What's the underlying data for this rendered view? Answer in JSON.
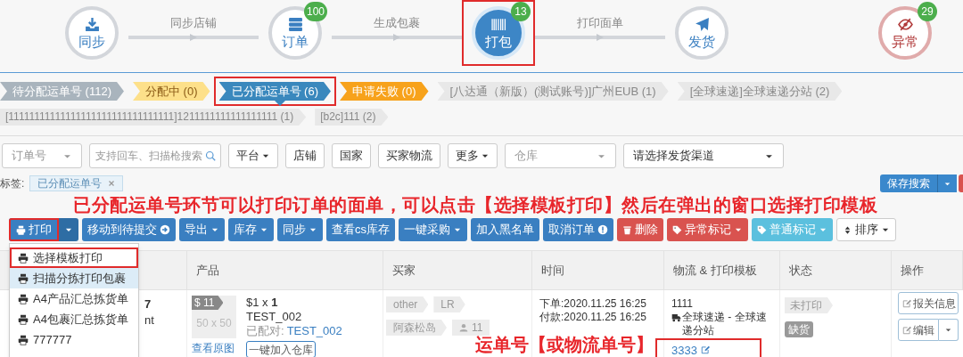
{
  "workflow": {
    "steps": [
      {
        "label": "同步",
        "kind": "normal",
        "highlighted": false
      },
      {
        "label": "订单",
        "kind": "normal",
        "badge": "100",
        "highlighted": false
      },
      {
        "label": "打包",
        "kind": "active",
        "badge": "13",
        "highlighted": true
      },
      {
        "label": "发货",
        "kind": "normal",
        "highlighted": false
      },
      {
        "label": "异常",
        "kind": "alert",
        "badge": "29",
        "highlighted": false
      }
    ],
    "connectors": [
      "同步店铺",
      "生成包裹",
      "打印面单"
    ]
  },
  "status_tabs": [
    {
      "label": "待分配运单号 (112)",
      "kind": "pending",
      "selected": false,
      "highlighted": false
    },
    {
      "label": "分配中 (0)",
      "kind": "progress",
      "selected": false,
      "highlighted": false
    },
    {
      "label": "已分配运单号 (6)",
      "kind": "assigned",
      "selected": true,
      "highlighted": true
    },
    {
      "label": "申请失败 (0)",
      "kind": "failed",
      "selected": false,
      "highlighted": false
    },
    {
      "label": "[八达通（新版）(测试账号)]广州EUB (1)",
      "kind": "channel",
      "selected": false,
      "highlighted": false
    },
    {
      "label": "[全球速递]全球速递分站 (2)",
      "kind": "channel",
      "selected": false,
      "highlighted": false
    }
  ],
  "more_channel_tabs": [
    {
      "label": "[11111111111111111111111111111111]1211111111111111111 (1)",
      "selected": false
    },
    {
      "label": "[b2c]111 (2)",
      "selected": false
    }
  ],
  "filters": {
    "order_field": {
      "placeholder": "订单号"
    },
    "search": {
      "placeholder": "支持回车、扫描枪搜索"
    },
    "buttons": [
      {
        "label": "平台",
        "dropdown": true
      },
      {
        "label": "店铺",
        "dropdown": false
      },
      {
        "label": "国家",
        "dropdown": false
      },
      {
        "label": "买家物流",
        "dropdown": false
      },
      {
        "label": "更多",
        "dropdown": true
      }
    ],
    "warehouse": {
      "placeholder": "仓库"
    },
    "channel": {
      "value": "请选择发货渠道"
    }
  },
  "tags": {
    "label": "标签:",
    "items": [
      "已分配运单号"
    ]
  },
  "save_search": "保存搜索",
  "annotations": [
    {
      "kind": "banner",
      "text": "已分配运单号环节可以打印订单的面单，可以点击【选择模板打印】然后在弹出的窗口选择打印模板"
    },
    {
      "kind": "callout",
      "text": "运单号【或物流单号】"
    }
  ],
  "toolbar": [
    {
      "label": "打印",
      "kind": "primary",
      "dropdown": true,
      "highlighted": true
    },
    {
      "label": "移动到待提交",
      "kind": "primary",
      "dropdown": false,
      "highlighted": false
    },
    {
      "label": "导出",
      "kind": "primary",
      "dropdown": true,
      "highlighted": false
    },
    {
      "label": "库存",
      "kind": "primary",
      "dropdown": true,
      "highlighted": false
    },
    {
      "label": "同步",
      "kind": "primary",
      "dropdown": true,
      "highlighted": false
    },
    {
      "label": "查看cs库存",
      "kind": "primary",
      "dropdown": false,
      "highlighted": false
    },
    {
      "label": "一键采购",
      "kind": "primary",
      "dropdown": true,
      "highlighted": false
    },
    {
      "label": "加入黑名单",
      "kind": "primary",
      "dropdown": false,
      "highlighted": false
    },
    {
      "label": "取消订单",
      "kind": "primary",
      "dropdown": false,
      "highlighted": false
    },
    {
      "label": "删除",
      "kind": "danger",
      "dropdown": false,
      "highlighted": false
    },
    {
      "label": "异常标记",
      "kind": "danger",
      "dropdown": true,
      "highlighted": false
    },
    {
      "label": "普通标记",
      "kind": "info",
      "dropdown": true,
      "highlighted": false
    },
    {
      "label": "排序",
      "kind": "default",
      "dropdown": true,
      "highlighted": false
    }
  ],
  "print_menu": {
    "items": [
      {
        "label": "选择模板打印",
        "selected": false,
        "highlighted": true
      },
      {
        "label": "扫描分拣打印包裹",
        "selected": true,
        "highlighted": false
      },
      {
        "label": "A4产品汇总拣货单",
        "selected": false,
        "highlighted": false
      },
      {
        "label": "A4包裹汇总拣货单",
        "selected": false,
        "highlighted": false
      },
      {
        "label": "777777",
        "selected": false,
        "highlighted": false
      }
    ]
  },
  "table": {
    "columns": [
      "产品",
      "买家",
      "时间",
      "物流 & 打印模板",
      "状态",
      "操作"
    ],
    "rows": [
      {
        "fragments": [
          "7",
          "nt"
        ],
        "product": {
          "price": "$ 11",
          "image": "50 x 50",
          "price_qty": "$1 x **1**",
          "name": "TEST_002",
          "paired_label": "已配对:",
          "paired_sku": "TEST_002",
          "view_image": "查看原图",
          "add_button": "一键加入仓库"
        },
        "buyer": {
          "tags": [
            "other",
            "LR"
          ],
          "country": "阿森松岛",
          "user_count": "11"
        },
        "time": [
          "下单:2020.11.25 16:25",
          "付款:2020.11.25 16:25"
        ],
        "logistics": {
          "code": "1111",
          "carrier": "全球速递 - 全球速递分站",
          "tracking": "3333",
          "highlighted": true
        },
        "status": {
          "print": "未打印",
          "stock": "缺货"
        },
        "actions": [
          {
            "label": "报关信息",
            "split": false
          },
          {
            "label": "编辑",
            "split": true
          }
        ]
      }
    ]
  }
}
